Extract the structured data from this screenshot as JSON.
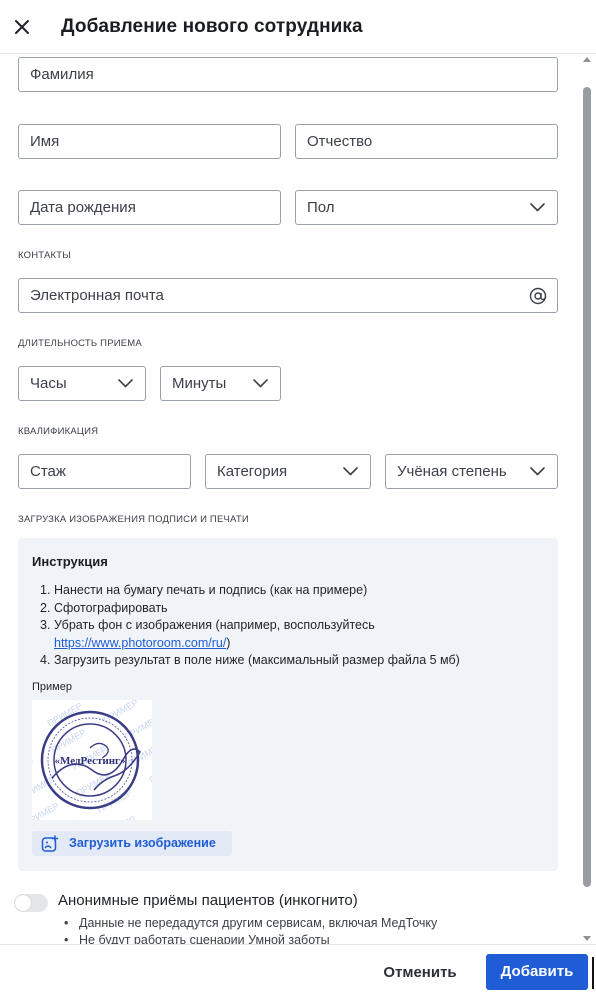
{
  "header": {
    "title": "Добавление нового сотрудника",
    "close_icon": "close-icon"
  },
  "form": {
    "last_name_placeholder": "Фамилия",
    "first_name_placeholder": "Имя",
    "patronymic_placeholder": "Отчество",
    "birth_date_placeholder": "Дата рождения",
    "gender_placeholder": "Пол",
    "contacts_label": "КОНТАКТЫ",
    "email_placeholder": "Электронная почта",
    "duration_label": "ДЛИТЕЛЬНОСТЬ ПРИЕМА",
    "hours_placeholder": "Часы",
    "minutes_placeholder": "Минуты",
    "qualification_label": "КВАЛИФИКАЦИЯ",
    "experience_placeholder": "Стаж",
    "category_placeholder": "Категория",
    "degree_placeholder": "Учёная степень",
    "signature_label": "ЗАГРУЗКА ИЗОБРАЖЕНИЯ ПОДПИСИ И ПЕЧАТИ"
  },
  "instruction": {
    "title": "Инструкция",
    "steps": [
      {
        "num": "1.",
        "text": "Нанести на бумагу печать и подпись (как на примере)"
      },
      {
        "num": "2.",
        "text": "Сфотографировать"
      },
      {
        "num": "3.",
        "text": "Убрать фон с изображения (например, воспользуйтесь"
      },
      {
        "num": "4.",
        "text": "Загрузить результат в поле ниже (максимальный размер файла 5 мб)"
      }
    ],
    "link_text": "https://www.photoroom.com/ru/",
    "link_suffix": ")",
    "example_label": "Пример",
    "example_watermark": "ПРИМЕР",
    "stamp_text": "«МедРестинг»",
    "upload_label": "Загрузить изображение"
  },
  "incognito": {
    "label": "Анонимные приёмы пациентов (инкогнито)",
    "enabled": false,
    "bullets": [
      "Данные не передадутся другим сервисам, включая МедТочку",
      "Не будут работать сценарии Умной заботы"
    ]
  },
  "footer": {
    "cancel_label": "Отменить",
    "add_label": "Добавить"
  },
  "colors": {
    "accent": "#1f5dd6",
    "instruction_bg": "#f0f3f8",
    "border": "#9aa1ab"
  }
}
